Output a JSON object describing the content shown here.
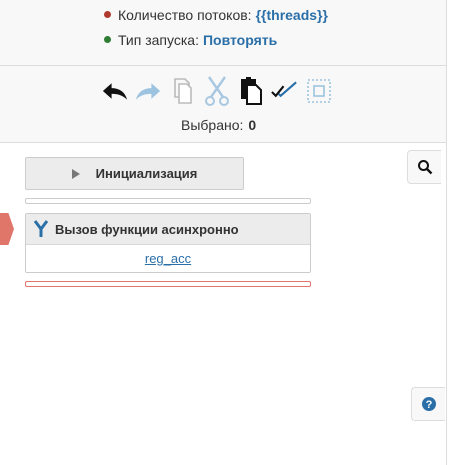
{
  "info": {
    "threads_label": "Количество потоков:",
    "threads_value": "{{threads}}",
    "launch_label": "Тип запуска:",
    "launch_value": "Повторять",
    "colors": {
      "threads_dot": "#b03a2e",
      "launch_dot": "#2e7d32",
      "value_link": "#2a6fa8"
    }
  },
  "toolbar": {
    "tools": [
      {
        "icon": "undo-icon",
        "state": "enabled"
      },
      {
        "icon": "redo-icon",
        "state": "disabled"
      },
      {
        "icon": "copy-icon",
        "state": "disabled"
      },
      {
        "icon": "cut-icon",
        "state": "disabled"
      },
      {
        "icon": "paste-icon",
        "state": "enabled"
      },
      {
        "icon": "select-all-icon",
        "state": "enabled"
      },
      {
        "icon": "deselect-icon",
        "state": "disabled"
      }
    ],
    "selected_label": "Выбрано:",
    "selected_count": "0"
  },
  "blocks": {
    "init_label": "Инициализация",
    "async_label": "Вызов функции асинхронно",
    "async_link": "reg_acc",
    "accent": "#e0756a"
  },
  "side": {
    "search_icon": "search-icon",
    "help_icon": "help-icon"
  }
}
